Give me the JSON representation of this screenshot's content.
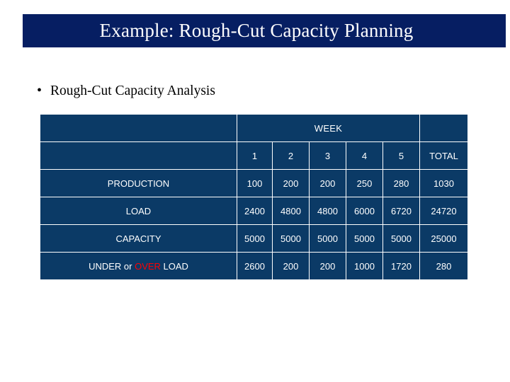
{
  "slide": {
    "title": "Example:  Rough-Cut Capacity Planning",
    "bullet_marker": "•",
    "bullet_text": "Rough-Cut Capacity Analysis",
    "colors": {
      "title_band": "#061e62",
      "table_fill": "#0b3a66",
      "table_text": "#ffffff",
      "over_highlight": "#ff0000"
    }
  },
  "table": {
    "group_header": "WEEK",
    "column_headers": [
      "1",
      "2",
      "3",
      "4",
      "5",
      "TOTAL"
    ],
    "rows": [
      {
        "label": "PRODUCTION",
        "label_parts": [
          {
            "text": "PRODUCTION",
            "color": "normal"
          }
        ],
        "values": [
          "100",
          "200",
          "200",
          "250",
          "280",
          "1030"
        ],
        "value_colors": [
          "normal",
          "normal",
          "normal",
          "normal",
          "normal",
          "normal"
        ]
      },
      {
        "label": "LOAD",
        "label_parts": [
          {
            "text": "LOAD",
            "color": "normal"
          }
        ],
        "values": [
          "2400",
          "4800",
          "4800",
          "6000",
          "6720",
          "24720"
        ],
        "value_colors": [
          "normal",
          "normal",
          "normal",
          "normal",
          "normal",
          "normal"
        ]
      },
      {
        "label": "CAPACITY",
        "label_parts": [
          {
            "text": "CAPACITY",
            "color": "normal"
          }
        ],
        "values": [
          "5000",
          "5000",
          "5000",
          "5000",
          "5000",
          "25000"
        ],
        "value_colors": [
          "normal",
          "normal",
          "normal",
          "normal",
          "normal",
          "normal"
        ]
      },
      {
        "label": "UNDER or OVER  LOAD",
        "label_parts": [
          {
            "text": "UNDER or ",
            "color": "normal"
          },
          {
            "text": "OVER",
            "color": "red"
          },
          {
            "text": "  LOAD",
            "color": "normal"
          }
        ],
        "values": [
          "2600",
          "200",
          "200",
          "1000",
          "1720",
          "280"
        ],
        "value_colors": [
          "normal",
          "normal",
          "normal",
          "red",
          "red",
          "normal"
        ]
      }
    ]
  }
}
